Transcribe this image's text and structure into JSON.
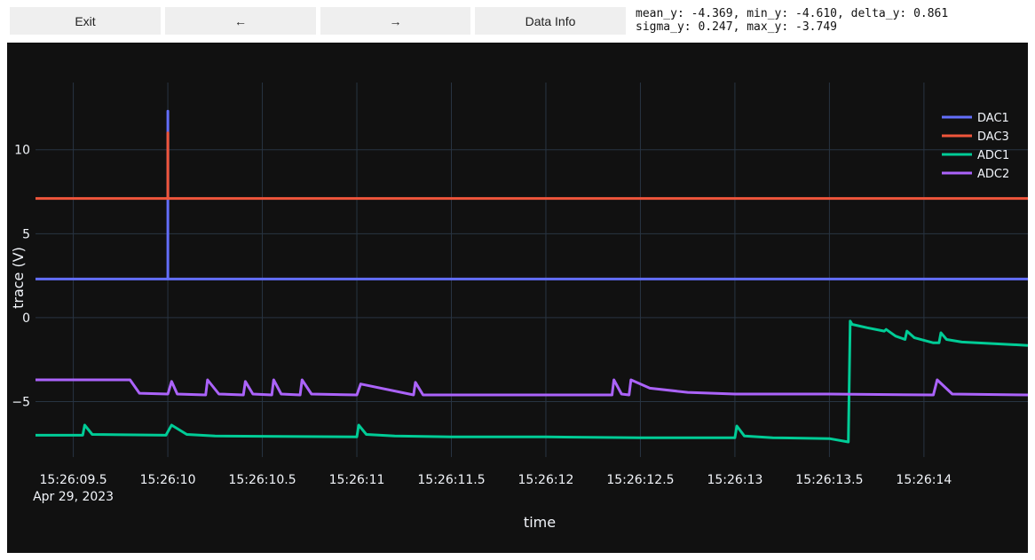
{
  "toolbar": {
    "exit_label": "Exit",
    "back_label": "←",
    "forward_label": "→",
    "info_label": "Data Info"
  },
  "stats": {
    "line1": "mean_y: -4.369, min_y: -4.610, delta_y: 0.861",
    "line2": "sigma_y: 0.247, max_y: -3.749"
  },
  "colors": {
    "background": "#111111",
    "grid": "#283442",
    "text": "#f2f5fa"
  },
  "chart_data": {
    "type": "line",
    "title": "",
    "xlabel": "time",
    "ylabel": "trace (V)",
    "date_label": "Apr 29, 2023",
    "xlim": [
      9.3,
      14.55
    ],
    "ylim": [
      -8.3,
      14.0
    ],
    "x_ticks": [
      {
        "value": 9.5,
        "label": "15:26:09.5"
      },
      {
        "value": 10.0,
        "label": "15:26:10"
      },
      {
        "value": 10.5,
        "label": "15:26:10.5"
      },
      {
        "value": 11.0,
        "label": "15:26:11"
      },
      {
        "value": 11.5,
        "label": "15:26:11.5"
      },
      {
        "value": 12.0,
        "label": "15:26:12"
      },
      {
        "value": 12.5,
        "label": "15:26:12.5"
      },
      {
        "value": 13.0,
        "label": "15:26:13"
      },
      {
        "value": 13.5,
        "label": "15:26:13.5"
      },
      {
        "value": 14.0,
        "label": "15:26:14"
      }
    ],
    "y_ticks": [
      {
        "value": 10,
        "label": "10"
      },
      {
        "value": 5,
        "label": "5"
      },
      {
        "value": 0,
        "label": "0"
      },
      {
        "value": -5,
        "label": "−5"
      }
    ],
    "grid": true,
    "legend_position": "top-right",
    "series": [
      {
        "name": "DAC1",
        "color": "#636efa",
        "x": [
          9.3,
          10.0,
          10.0,
          10.0,
          14.55
        ],
        "y": [
          2.3,
          2.3,
          12.3,
          2.3,
          2.3
        ]
      },
      {
        "name": "DAC3",
        "color": "#ef553b",
        "x": [
          9.3,
          10.0,
          10.0,
          10.0,
          14.55
        ],
        "y": [
          7.1,
          7.1,
          11.0,
          7.1,
          7.1
        ]
      },
      {
        "name": "ADC1",
        "color": "#00cc96",
        "x": [
          9.3,
          9.55,
          9.56,
          9.6,
          9.99,
          10.02,
          10.1,
          10.25,
          11.0,
          11.01,
          11.05,
          11.2,
          11.5,
          12.0,
          12.5,
          13.0,
          13.01,
          13.05,
          13.2,
          13.5,
          13.6,
          13.61,
          13.62,
          13.7,
          13.79,
          13.8,
          13.85,
          13.9,
          13.91,
          13.95,
          14.05,
          14.08,
          14.09,
          14.12,
          14.2,
          14.55
        ],
        "y": [
          -7.0,
          -7.0,
          -6.4,
          -6.95,
          -7.0,
          -6.4,
          -6.95,
          -7.05,
          -7.1,
          -6.4,
          -6.95,
          -7.05,
          -7.1,
          -7.1,
          -7.15,
          -7.15,
          -6.45,
          -7.05,
          -7.15,
          -7.2,
          -7.4,
          -0.2,
          -0.4,
          -0.6,
          -0.8,
          -0.7,
          -1.1,
          -1.3,
          -0.8,
          -1.2,
          -1.5,
          -1.5,
          -0.9,
          -1.3,
          -1.45,
          -1.65
        ]
      },
      {
        "name": "ADC2",
        "color": "#ab63fa",
        "x": [
          9.3,
          9.8,
          9.85,
          10.0,
          10.02,
          10.05,
          10.2,
          10.21,
          10.27,
          10.4,
          10.41,
          10.45,
          10.55,
          10.56,
          10.6,
          10.7,
          10.71,
          10.76,
          11.0,
          11.02,
          11.3,
          11.31,
          11.35,
          12.35,
          12.36,
          12.4,
          12.44,
          12.45,
          12.55,
          12.75,
          13.0,
          13.5,
          14.05,
          14.07,
          14.15,
          14.55
        ],
        "y": [
          -3.7,
          -3.7,
          -4.5,
          -4.55,
          -3.8,
          -4.55,
          -4.6,
          -3.7,
          -4.55,
          -4.6,
          -3.8,
          -4.55,
          -4.6,
          -3.7,
          -4.55,
          -4.6,
          -3.7,
          -4.55,
          -4.6,
          -3.95,
          -4.6,
          -3.85,
          -4.6,
          -4.6,
          -3.7,
          -4.55,
          -4.6,
          -3.7,
          -4.2,
          -4.45,
          -4.55,
          -4.55,
          -4.6,
          -3.7,
          -4.55,
          -4.6
        ]
      }
    ]
  }
}
